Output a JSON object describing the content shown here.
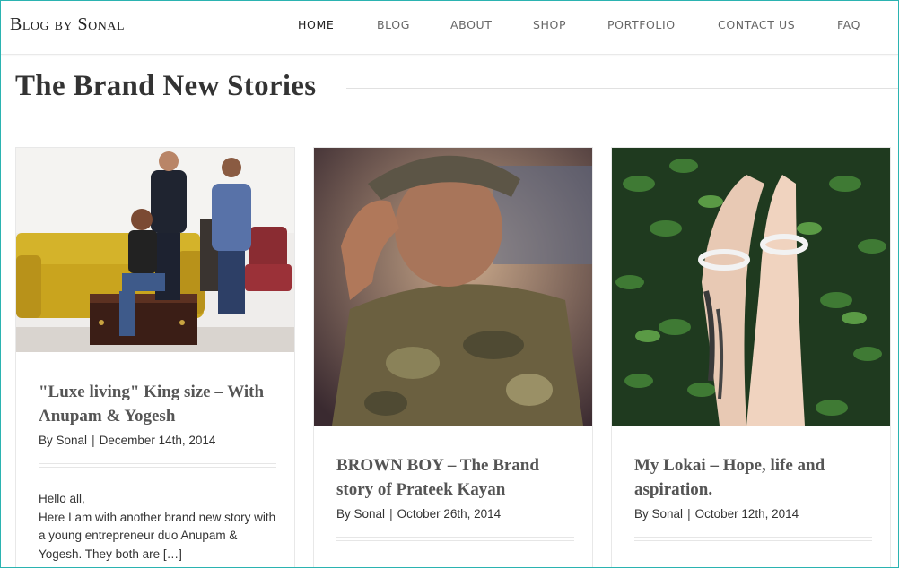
{
  "site": {
    "brand": "Blog by Sonal"
  },
  "nav": {
    "items": [
      {
        "label": "HOME",
        "active": true
      },
      {
        "label": "BLOG",
        "active": false
      },
      {
        "label": "ABOUT",
        "active": false
      },
      {
        "label": "SHOP",
        "active": false
      },
      {
        "label": "PORTFOLIO",
        "active": false
      },
      {
        "label": "CONTACT US",
        "active": false
      },
      {
        "label": "FAQ",
        "active": false
      }
    ]
  },
  "page": {
    "title": "The Brand New Stories"
  },
  "posts": [
    {
      "title": "\"Luxe living\" King size – With Anupam & Yogesh",
      "author_prefix": "By",
      "author": "Sonal",
      "date": "December 14th, 2014",
      "excerpt_line1": "Hello all,",
      "excerpt_line2": "Here I am with another brand new story with a young entrepreneur duo Anupam & Yogesh. They both are […]"
    },
    {
      "title": "BROWN BOY – The Brand story of Prateek Kayan",
      "author_prefix": "By",
      "author": "Sonal",
      "date": "October 26th, 2014"
    },
    {
      "title": "My Lokai – Hope, life and aspiration.",
      "author_prefix": "By",
      "author": "Sonal",
      "date": "October 12th, 2014"
    }
  ],
  "colors": {
    "frame": "#2bb3b1",
    "rule": "#e1e1e1",
    "text": "#333333"
  }
}
